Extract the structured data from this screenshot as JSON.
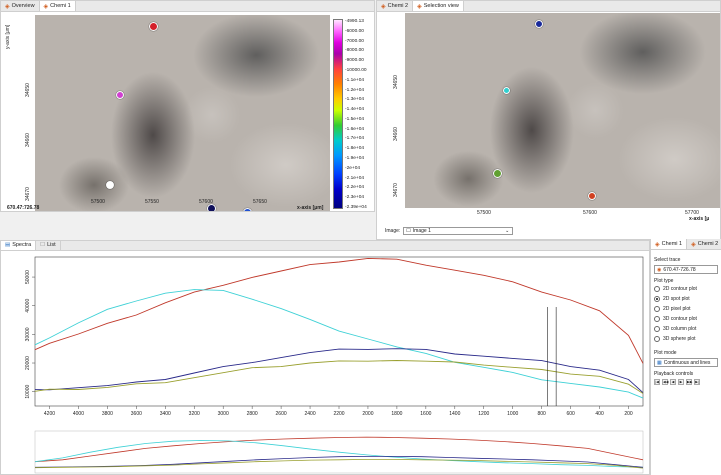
{
  "left_panel": {
    "tabs": [
      {
        "label": "Overview",
        "active": false
      },
      {
        "label": "Chemi 1",
        "active": true
      }
    ],
    "ylabel": "y-axis [μm]",
    "xlabel": "x-axis [μm]",
    "x_ticks": [
      "57500",
      "57550",
      "57600",
      "57650"
    ],
    "y_ticks": [
      "34650",
      "34660",
      "34670"
    ],
    "coord_readout": "670.47:726.78",
    "colorbar_labels": [
      "-4990.13",
      "-6000.00",
      "-7000.00",
      "-8000.00",
      "-9000.00",
      "-10000.00",
      "-1.1e+04",
      "-1.2e+04",
      "-1.3e+04",
      "-1.4e+04",
      "-1.5e+04",
      "-1.6e+04",
      "-1.7e+04",
      "-1.8e+04",
      "-1.9e+04",
      "-2e+04",
      "-2.1e+04",
      "-2.2e+04",
      "-2.3e+04",
      "-2.39e+04"
    ],
    "spots_colors": [
      "#d4202a",
      "#d040d0",
      "#ffffff",
      "#10105a",
      "#2050d0"
    ]
  },
  "right_panel": {
    "tabs": [
      {
        "label": "Chemi 2",
        "active": false
      },
      {
        "label": "Selection view",
        "active": true
      }
    ],
    "x_ticks": [
      "57500",
      "57600",
      "57700"
    ],
    "y_ticks": [
      "34650",
      "34660",
      "34670"
    ],
    "xlabel": "x-axis [μ",
    "image_label": "Image:",
    "image_value": "Image 1",
    "spots_colors": [
      "#1a2a9a",
      "#30d0d0",
      "#60a030",
      "#d04020"
    ]
  },
  "spectra_panel": {
    "tabs": [
      {
        "label": "Spectra",
        "active": true
      },
      {
        "label": "List",
        "active": false
      }
    ]
  },
  "chart_data": {
    "type": "line",
    "x": [
      4300,
      4200,
      4000,
      3800,
      3600,
      3400,
      3200,
      3000,
      2800,
      2600,
      2400,
      2200,
      2000,
      1800,
      1600,
      1400,
      1200,
      1000,
      800,
      600,
      400,
      200,
      100
    ],
    "x_ticks": [
      "4200",
      "4000",
      "3800",
      "3600",
      "3400",
      "3200",
      "3000",
      "2800",
      "2600",
      "2400",
      "2200",
      "2000",
      "1800",
      "1600",
      "1400",
      "1200",
      "1000",
      "800",
      "600",
      "400",
      "200"
    ],
    "y_ticks": [
      "10000",
      "20000",
      "30000",
      "40000",
      "50000"
    ],
    "ylim": [
      5000,
      57000
    ],
    "xlim": [
      4300,
      100
    ],
    "series": [
      {
        "color": "#c0392b",
        "values": [
          25000,
          27000,
          30000,
          33500,
          37000,
          41000,
          44500,
          47500,
          50000,
          52000,
          54000,
          55500,
          56500,
          56000,
          54500,
          52500,
          50500,
          48000,
          45000,
          42000,
          38000,
          30000,
          20000
        ]
      },
      {
        "color": "#3fd1d6",
        "values": [
          26000,
          29000,
          34000,
          38500,
          42000,
          44500,
          45500,
          45000,
          42500,
          39000,
          35000,
          31500,
          28500,
          25500,
          23000,
          20500,
          18500,
          16500,
          14500,
          13000,
          11500,
          9500,
          8000
        ]
      },
      {
        "color": "#2a2a8a",
        "values": [
          10500,
          11000,
          11500,
          12000,
          13000,
          14500,
          16500,
          18500,
          20500,
          22000,
          23500,
          24500,
          25000,
          25000,
          24500,
          23500,
          22500,
          21500,
          20500,
          19000,
          17500,
          14000,
          10000
        ]
      },
      {
        "color": "#9aa030",
        "values": [
          10000,
          10500,
          11000,
          11500,
          12500,
          13500,
          15000,
          16500,
          18000,
          19000,
          20000,
          20500,
          21000,
          21000,
          20500,
          20000,
          19500,
          18500,
          17500,
          16500,
          15500,
          12500,
          9000
        ]
      }
    ],
    "cursor_lines_x": [
      760,
      700
    ]
  },
  "overview_chart": {
    "series": [
      {
        "color": "#c0392b",
        "values": [
          0.3,
          0.35,
          0.45,
          0.55,
          0.65,
          0.72,
          0.78,
          0.83,
          0.87,
          0.9,
          0.92,
          0.94,
          0.95,
          0.94,
          0.92,
          0.9,
          0.87,
          0.83,
          0.78,
          0.72,
          0.65,
          0.5,
          0.35
        ]
      },
      {
        "color": "#3fd1d6",
        "values": [
          0.3,
          0.4,
          0.55,
          0.68,
          0.78,
          0.84,
          0.86,
          0.85,
          0.8,
          0.72,
          0.63,
          0.55,
          0.48,
          0.42,
          0.37,
          0.33,
          0.3,
          0.27,
          0.25,
          0.22,
          0.2,
          0.17,
          0.15
        ]
      },
      {
        "color": "#2a2a8a",
        "values": [
          0.15,
          0.16,
          0.17,
          0.18,
          0.2,
          0.23,
          0.27,
          0.31,
          0.35,
          0.38,
          0.41,
          0.43,
          0.44,
          0.44,
          0.43,
          0.41,
          0.39,
          0.37,
          0.35,
          0.32,
          0.29,
          0.22,
          0.15
        ]
      },
      {
        "color": "#9aa030",
        "values": [
          0.14,
          0.15,
          0.16,
          0.17,
          0.19,
          0.21,
          0.24,
          0.27,
          0.3,
          0.32,
          0.34,
          0.35,
          0.36,
          0.36,
          0.35,
          0.34,
          0.33,
          0.31,
          0.29,
          0.27,
          0.25,
          0.2,
          0.13
        ]
      }
    ]
  },
  "control_panel": {
    "tabs": [
      {
        "label": "Chemi 1",
        "active": true
      },
      {
        "label": "Chemi 2",
        "active": false
      }
    ],
    "select_trace_label": "Select trace",
    "select_trace_value": "670.47-726.78",
    "plot_type_label": "Plot type",
    "plot_types": [
      {
        "label": "2D contour plot",
        "selected": false
      },
      {
        "label": "2D spot plot",
        "selected": true
      },
      {
        "label": "2D pixel plot",
        "selected": false
      },
      {
        "label": "3D contour plot",
        "selected": false
      },
      {
        "label": "3D column plot",
        "selected": false
      },
      {
        "label": "3D sphere plot",
        "selected": false
      }
    ],
    "plot_mode_label": "Plot mode",
    "plot_mode_value": "Continuous and lines",
    "playback_label": "Playback controls",
    "playback_buttons": [
      "|◀",
      "◀◀",
      "◀",
      "▶",
      "▶▶",
      "▶|"
    ]
  }
}
